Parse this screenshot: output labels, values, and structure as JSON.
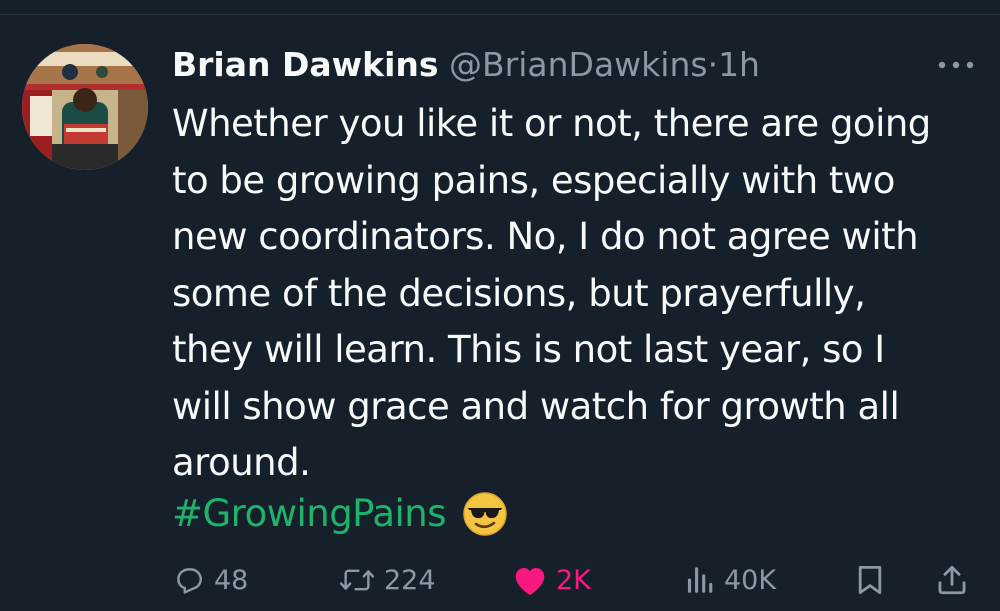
{
  "tweet": {
    "display_name": "Brian Dawkins",
    "handle": "@BrianDawkins",
    "separator": "·",
    "time": "1h",
    "lines": [
      "Whether you like it or not, there are going",
      "to be growing pains, especially with two",
      "new coordinators. No, I do not agree with",
      "some of the decisions, but prayerfully,",
      "they will learn. This is not last year, so I",
      "will show grace and watch for growth all",
      "around."
    ],
    "hashtag": "#GrowingPains",
    "emoji": "sunglasses-emoji"
  },
  "actions": {
    "replies": "48",
    "reposts": "224",
    "likes": "2K",
    "views": "40K"
  },
  "colors": {
    "background": "#15202b",
    "text": "#f7f9f9",
    "muted": "#8b98a5",
    "hashtag": "#1fb26b",
    "like": "#f91880"
  }
}
